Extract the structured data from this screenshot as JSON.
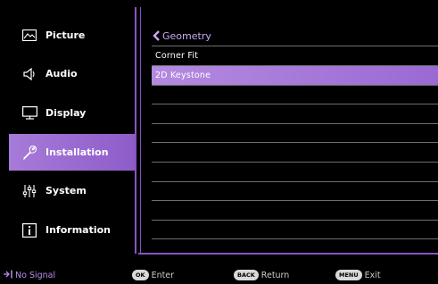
{
  "sidebar": {
    "items": [
      {
        "label": "Picture",
        "icon": "picture-icon"
      },
      {
        "label": "Audio",
        "icon": "speaker-icon"
      },
      {
        "label": "Display",
        "icon": "monitor-icon"
      },
      {
        "label": "Installation",
        "icon": "wrench-icon",
        "active": true
      },
      {
        "label": "System",
        "icon": "sliders-icon"
      },
      {
        "label": "Information",
        "icon": "info-icon"
      }
    ]
  },
  "panel": {
    "title": "Geometry",
    "rows": [
      {
        "label": "Corner Fit"
      },
      {
        "label": "2D Keystone",
        "selected": true
      }
    ]
  },
  "footer": {
    "signal": "No Signal",
    "ok_key": "OK",
    "ok_label": "Enter",
    "back_key": "BACK",
    "back_label": "Return",
    "menu_key": "MENU",
    "menu_label": "Exit"
  },
  "colors": {
    "accent": "#8a52c8",
    "highlight": "#a77bd9",
    "title_text": "#c9a9f2"
  }
}
